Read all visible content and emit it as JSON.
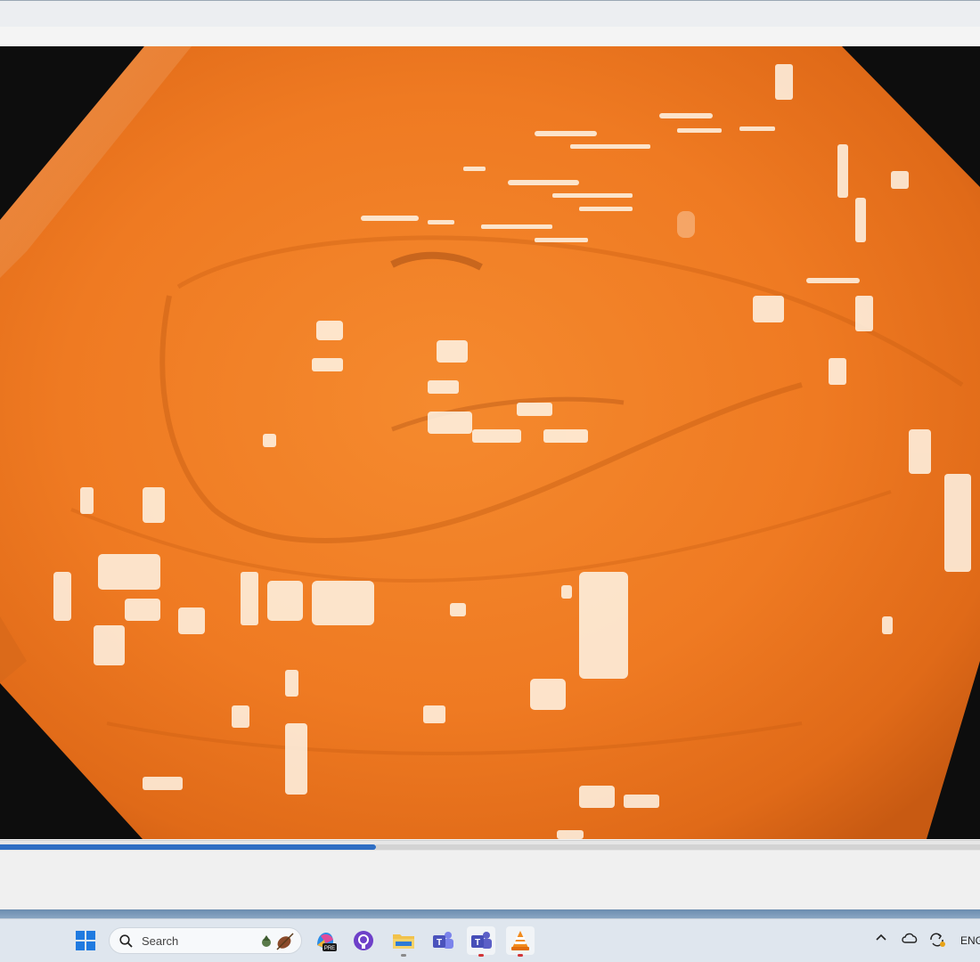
{
  "window": {
    "playback_progress": 0.384
  },
  "taskbar": {
    "search_label": "Search",
    "language": "ENG",
    "apps": [
      {
        "name": "start",
        "icon": "windows-start-icon"
      },
      {
        "name": "copilot",
        "icon": "copilot-pre-icon",
        "badge": "PRE"
      },
      {
        "name": "github",
        "icon": "github-icon"
      },
      {
        "name": "file-explorer",
        "icon": "folder-icon"
      },
      {
        "name": "teams-classic",
        "icon": "teams-icon"
      },
      {
        "name": "teams",
        "icon": "teams-icon"
      },
      {
        "name": "vlc",
        "icon": "vlc-cone-icon"
      }
    ],
    "tray": [
      "chevron-up-icon",
      "onedrive-cloud-icon",
      "sync-icon"
    ]
  },
  "colors": {
    "tissue": "#f07a22",
    "progress": "#2f6ec3",
    "frame": "#0d0d0d"
  }
}
